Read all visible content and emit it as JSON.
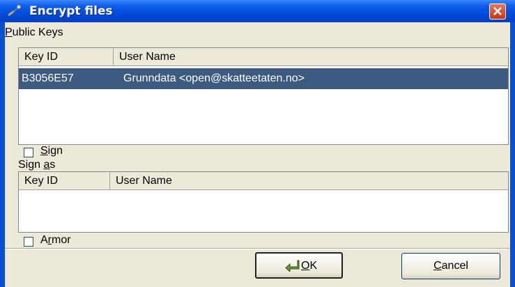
{
  "window": {
    "title": "Encrypt files",
    "title_icon": "key-pen-icon",
    "close_icon": "close-icon"
  },
  "public_keys": {
    "label_first": "P",
    "label_rest": "ublic Keys",
    "columns": [
      "Key ID",
      "User Name"
    ],
    "rows": [
      {
        "key_id": "B3056E57",
        "user_name": "Grunndata <open@skatteetaten.no>",
        "selected": true
      }
    ]
  },
  "sign": {
    "checked": false,
    "label_first": "S",
    "label_rest": "ign"
  },
  "sign_as": {
    "label_pre": "Sign ",
    "label_u": "a",
    "label_post": "s",
    "columns": [
      "Key ID",
      "User Name"
    ],
    "rows": []
  },
  "armor": {
    "checked": false,
    "label_pre": "A",
    "label_u": "r",
    "label_post": "mor"
  },
  "buttons": {
    "ok_u": "O",
    "ok_rest": "K",
    "ok_icon": "enter-arrow-icon",
    "cancel_u": "C",
    "cancel_rest": "ancel"
  }
}
